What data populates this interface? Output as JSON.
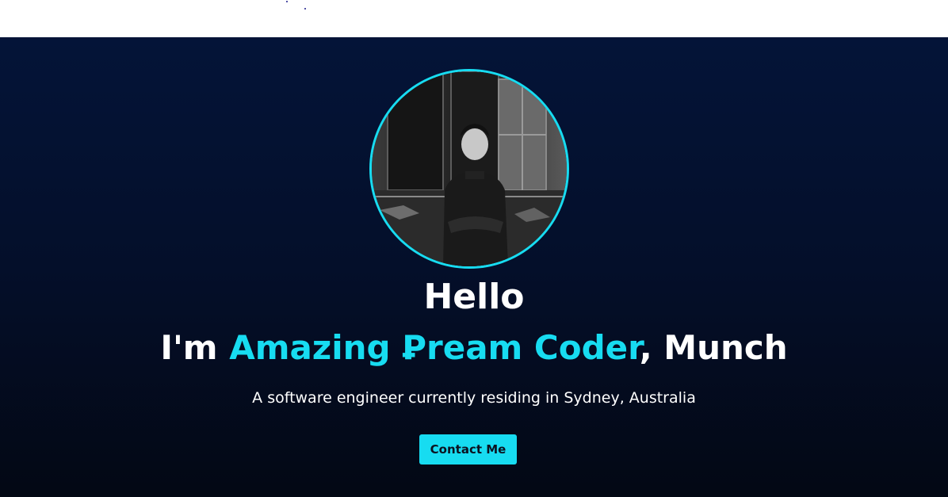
{
  "hero": {
    "avatar_alt": "Portrait photo of Munch",
    "greeting": "Hello",
    "intro_prefix": "I'm ",
    "intro_highlight": "Amazing Ꝑream Coder",
    "intro_suffix": ", Munch",
    "subtitle": "A software engineer currently residing in Sydney, Australia",
    "contact_label": "Contact Me"
  },
  "colors": {
    "accent": "#17dcf1",
    "background_top": "#041438",
    "background_bottom": "#030814",
    "text": "#ffffff",
    "button_text": "#0b1220"
  }
}
